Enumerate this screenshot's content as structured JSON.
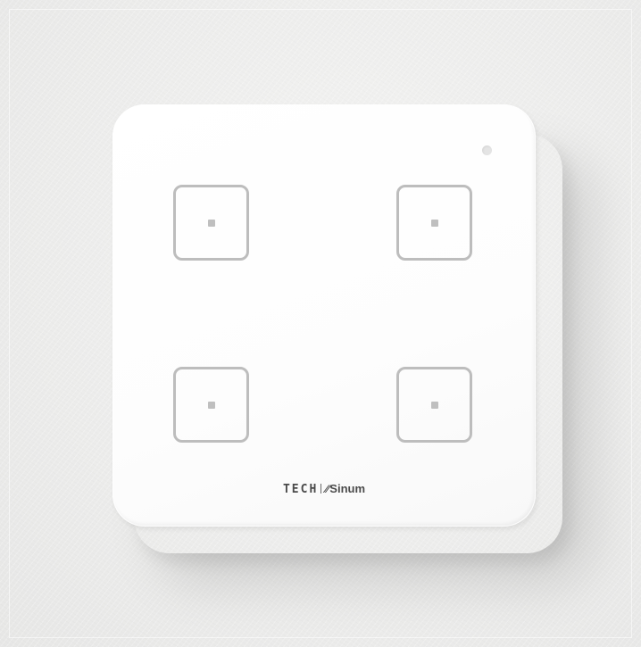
{
  "scene": {
    "background_color": "#ededec",
    "panel_color": "#ffffff",
    "key_outline_color": "#bdbdbd"
  },
  "device": {
    "brand": "TECH",
    "sub_brand_mark": "⁄⁄",
    "sub_brand": "Sinum",
    "keys": [
      {
        "position": "top-left"
      },
      {
        "position": "top-right"
      },
      {
        "position": "bottom-left"
      },
      {
        "position": "bottom-right"
      }
    ]
  }
}
